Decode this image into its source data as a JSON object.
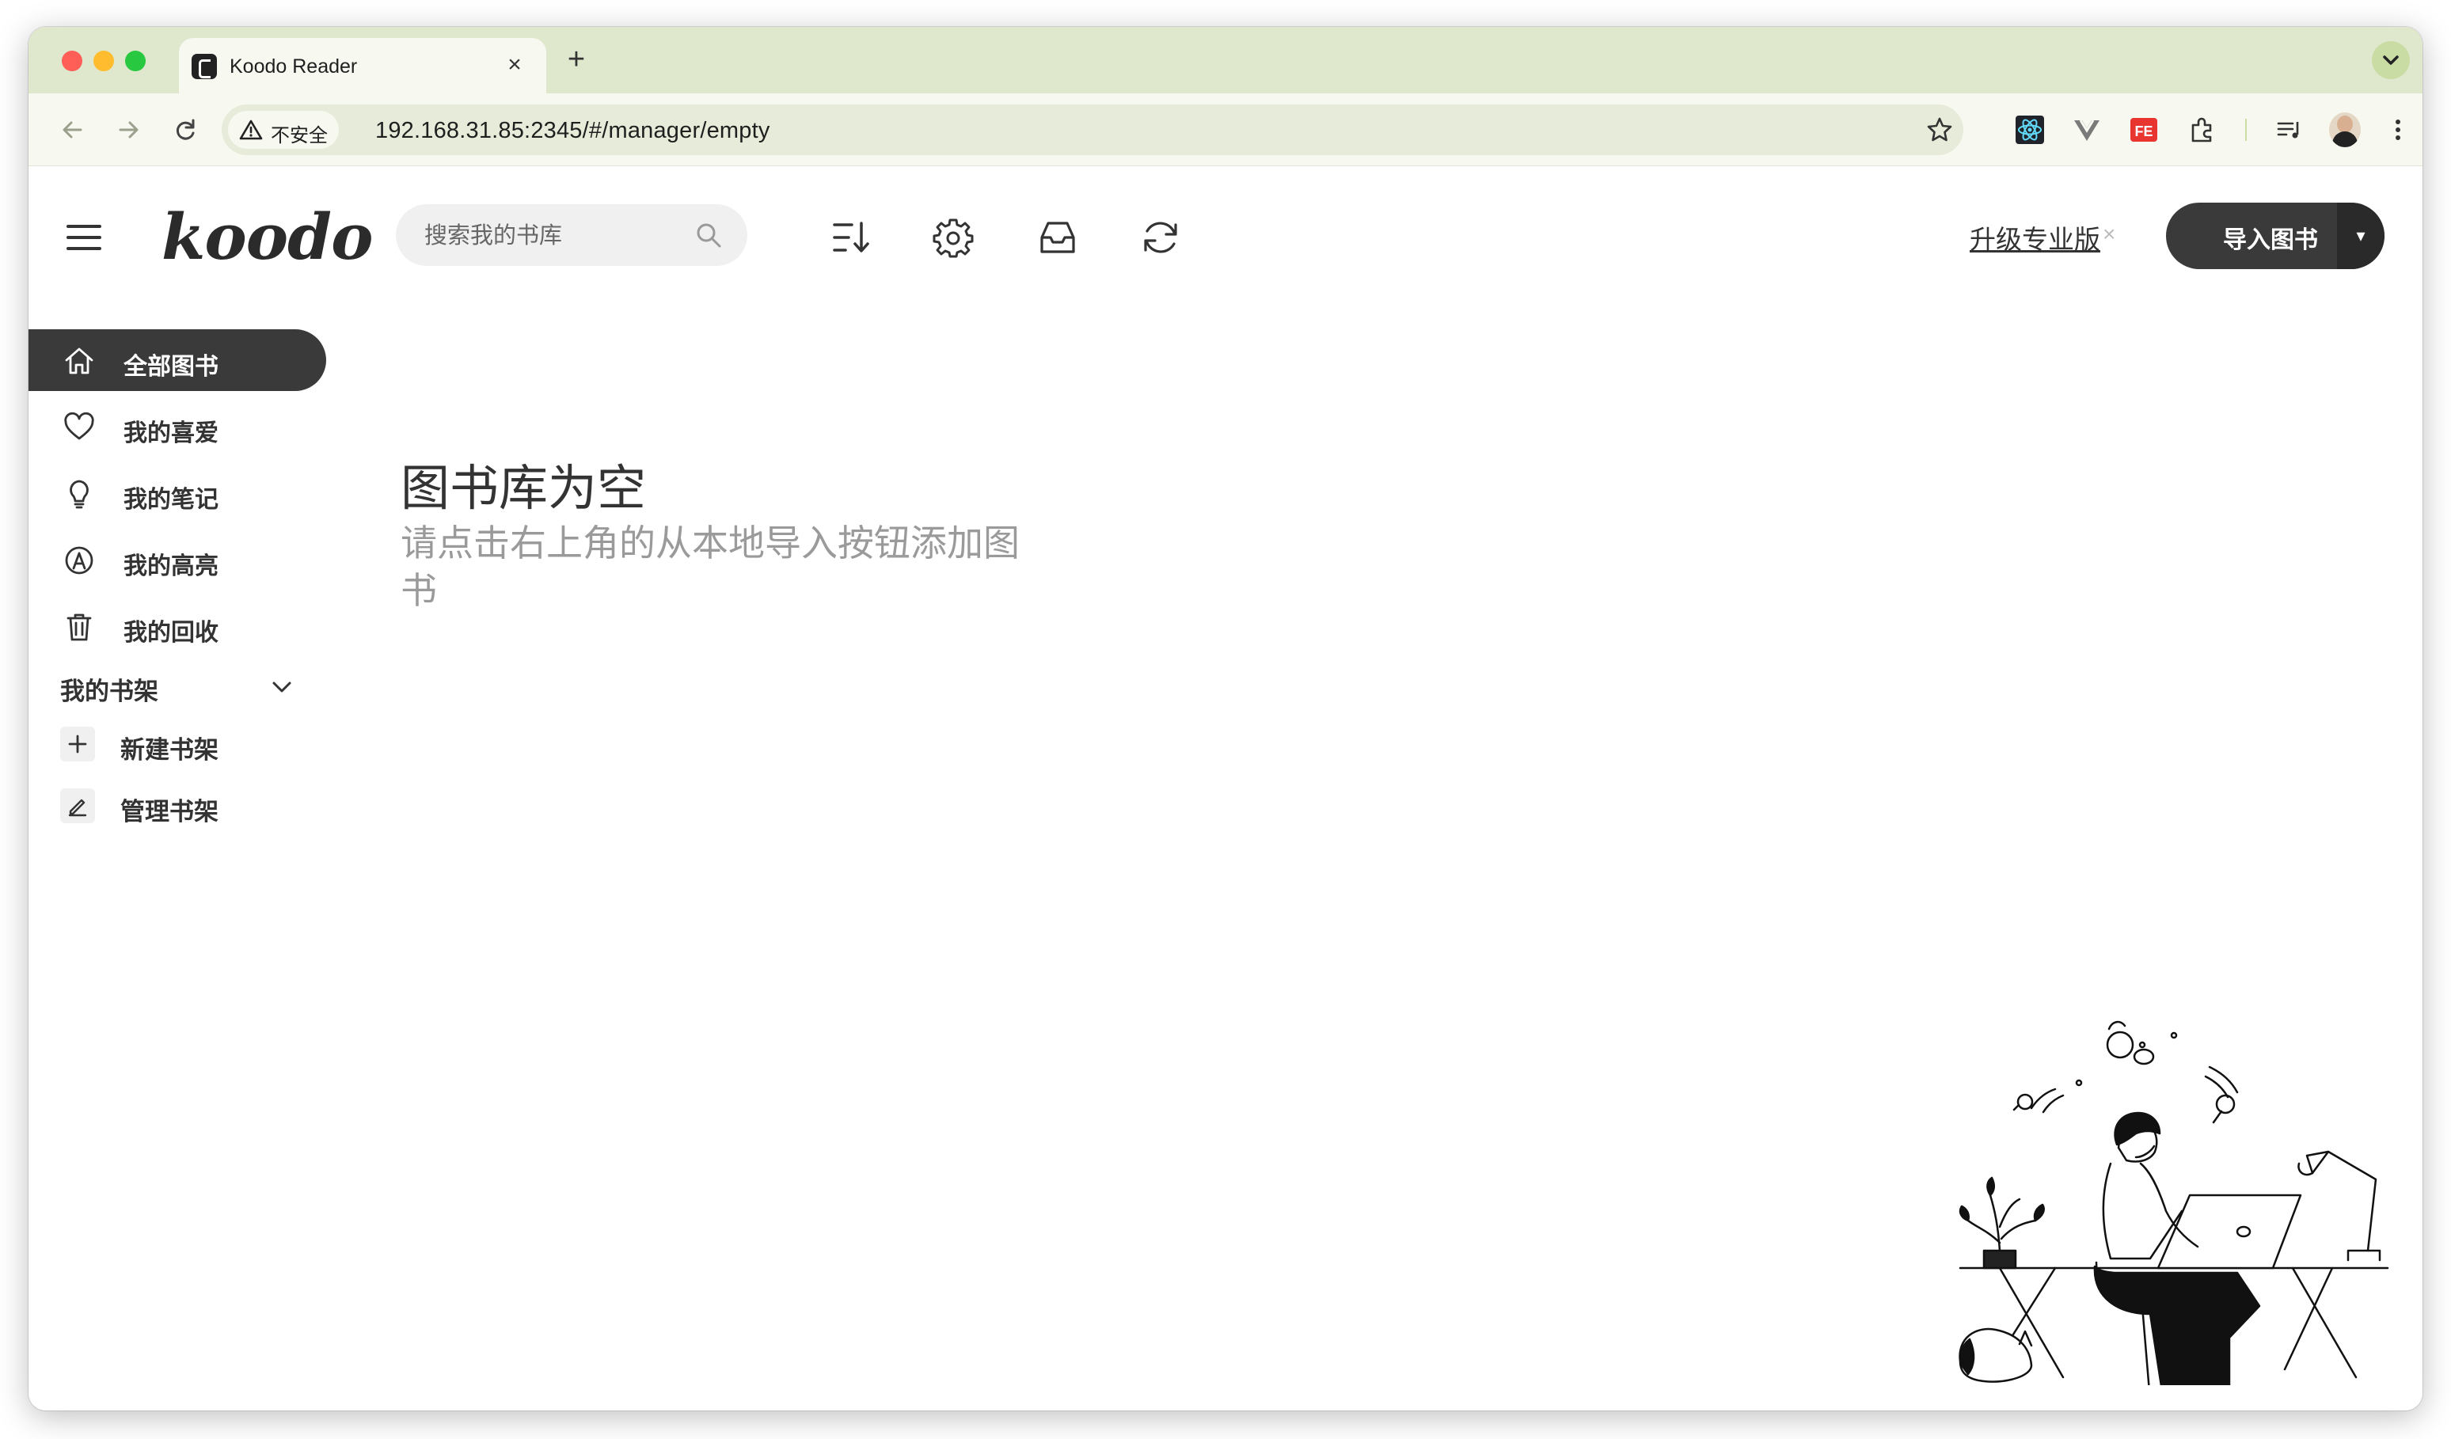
{
  "browser": {
    "tab_title": "Koodo Reader",
    "tab_close": "×",
    "new_tab": "+",
    "security_label": "不安全",
    "url": "192.168.31.85:2345/#/manager/empty",
    "accent_color": "#dfe7cc"
  },
  "app": {
    "logo": "koodo",
    "search_placeholder": "搜索我的书库",
    "upgrade_label": "升级专业版",
    "upgrade_close": "×",
    "import_label": "导入图书",
    "import_arrow": "▾"
  },
  "sidebar": {
    "items": [
      {
        "label": "全部图书",
        "icon": "home-icon",
        "active": true
      },
      {
        "label": "我的喜爱",
        "icon": "heart-icon",
        "active": false
      },
      {
        "label": "我的笔记",
        "icon": "lightbulb-icon",
        "active": false
      },
      {
        "label": "我的高亮",
        "icon": "highlight-icon",
        "active": false
      },
      {
        "label": "我的回收",
        "icon": "trash-icon",
        "active": false
      }
    ],
    "shelf_header": "我的书架",
    "shelf_actions": [
      {
        "label": "新建书架",
        "icon": "plus-icon"
      },
      {
        "label": "管理书架",
        "icon": "edit-icon"
      }
    ]
  },
  "empty_state": {
    "title": "图书库为空",
    "description": "请点击右上角的从本地导入按钮添加图书"
  }
}
